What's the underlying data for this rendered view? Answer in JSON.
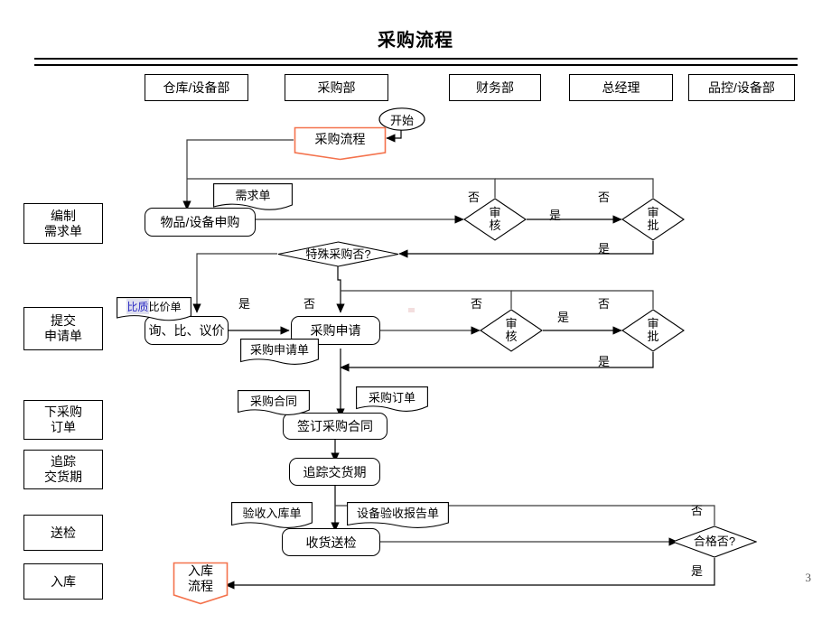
{
  "document": {
    "title": "采购流程",
    "page_number": "3",
    "accent_orange": "#F4724C",
    "line_color": "#000000",
    "highlight_blue": "#2B2BC4"
  },
  "columns": [
    {
      "id": "warehouse",
      "label": "仓库/设备部"
    },
    {
      "id": "purchasing",
      "label": "采购部"
    },
    {
      "id": "finance",
      "label": "财务部"
    },
    {
      "id": "gm",
      "label": "总经理"
    },
    {
      "id": "qc",
      "label": "品控/设备部"
    }
  ],
  "stages": [
    {
      "id": "stage-requisition",
      "line1": "编制",
      "line2": "需求单"
    },
    {
      "id": "stage-application",
      "line1": "提交",
      "line2": "申请单"
    },
    {
      "id": "stage-order",
      "line1": "下采购",
      "line2": "订单"
    },
    {
      "id": "stage-delivery",
      "line1": "追踪",
      "line2": "交货期"
    },
    {
      "id": "stage-inspection",
      "line1": "送检",
      "line2": ""
    },
    {
      "id": "stage-storage",
      "line1": "入库",
      "line2": ""
    }
  ],
  "nodes": {
    "start": {
      "label": "开始"
    },
    "banner_start": {
      "line1": "采购流程",
      "line2": ""
    },
    "banner_end": {
      "line1": "入库",
      "line2": "流程"
    },
    "apply_goods": {
      "label": "物品/设备申购"
    },
    "negotiate": {
      "label": "询、比、议价"
    },
    "purchase_request": {
      "label": "采购申请"
    },
    "sign_contract": {
      "label": "签订采购合同"
    },
    "track_delivery": {
      "label": "追踪交货期"
    },
    "receive_inspect": {
      "label": "收货送检"
    }
  },
  "documents": [
    {
      "id": "doc-demand",
      "label": "需求单",
      "style": "plain"
    },
    {
      "id": "doc-price-compare",
      "label": "比质比价单",
      "highlight_part": "比质",
      "rest_part": "比价单",
      "style": "highlight"
    },
    {
      "id": "doc-purchase-request",
      "label": "采购申请单",
      "style": "plain"
    },
    {
      "id": "doc-contract",
      "label": "采购合同",
      "style": "plain"
    },
    {
      "id": "doc-order",
      "label": "采购订单",
      "style": "plain"
    },
    {
      "id": "doc-receipt",
      "label": "验收入库单",
      "style": "plain"
    },
    {
      "id": "doc-equip-report",
      "label": "设备验收报告单",
      "style": "blue"
    }
  ],
  "decisions": [
    {
      "id": "review-1",
      "line1": "审",
      "line2": "核"
    },
    {
      "id": "approve-1",
      "line1": "审",
      "line2": "批"
    },
    {
      "id": "special-purchase",
      "line1": "特殊采购否?",
      "line2": ""
    },
    {
      "id": "review-2",
      "line1": "审",
      "line2": "核"
    },
    {
      "id": "approve-2",
      "line1": "审",
      "line2": "批"
    },
    {
      "id": "qualified",
      "line1": "合格否?",
      "line2": ""
    }
  ],
  "branch_labels": {
    "no": "否",
    "yes": "是",
    "r1_no": "否",
    "r1_yes": "是",
    "a1_no": "否",
    "a1_yes": "是",
    "sp_yes": "是",
    "sp_no": "否",
    "r2_no": "否",
    "r2_yes": "是",
    "a2_no": "否",
    "a2_yes": "是",
    "q_no": "否",
    "q_yes": "是"
  }
}
